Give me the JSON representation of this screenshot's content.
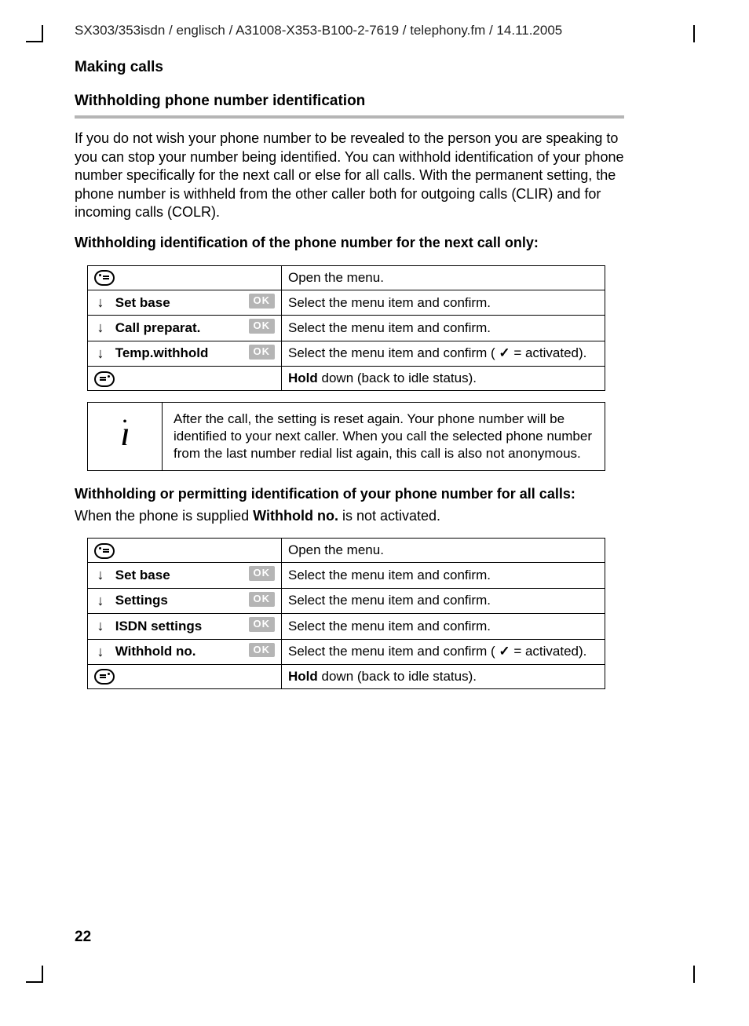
{
  "header_line": "SX303/353isdn / englisch / A31008-X353-B100-2-7619 / telephony.fm / 14.11.2005",
  "section_title": "Making calls",
  "subsection_title": "Withholding phone number identification",
  "intro_text": "If you do not wish your phone number to be revealed to the person you are speaking to you can stop your number being identified. You can withhold identification of your phone number specifically for the next call or else for all calls. With the permanent setting, the phone number is withheld from the other caller both for outgoing calls (CLIR) and for incoming calls (COLR).",
  "proc1_title": "Withholding identification of the phone number for the next call only:",
  "ok_label": "OK",
  "proc1": {
    "r0_desc": "Open the menu.",
    "r1_label": "Set base",
    "r1_desc": "Select the menu item and confirm.",
    "r2_label": "Call preparat.",
    "r2_desc": "Select the menu item and confirm.",
    "r3_label": "Temp.withhold",
    "r3_desc_a": "Select the menu item and confirm ( ",
    "r3_desc_b": " = activated).",
    "r4_desc_a": "Hold",
    "r4_desc_b": " down (back to idle status)."
  },
  "note_text": "After the call, the setting is reset again. Your phone number will be identified to your next caller. When you call the selected phone number from the last number redial list again, this call is also not anonymous.",
  "proc2_title": "Withholding or permitting identification of your phone number for all calls:",
  "proc2_intro_a": "When the phone is supplied ",
  "proc2_intro_bold": "Withhold no.",
  "proc2_intro_b": " is not activated.",
  "proc2": {
    "r0_desc": "Open the menu.",
    "r1_label": "Set base",
    "r1_desc": "Select the menu item and confirm.",
    "r2_label": "Settings",
    "r2_desc": "Select the menu item and confirm.",
    "r3_label": "ISDN settings",
    "r3_desc": "Select the menu item and confirm.",
    "r4_label": "Withhold no.",
    "r4_desc_a": "Select the menu item and confirm ( ",
    "r4_desc_b": " = activated).",
    "r5_desc_a": "Hold",
    "r5_desc_b": " down (back to idle status)."
  },
  "page_number": "22"
}
